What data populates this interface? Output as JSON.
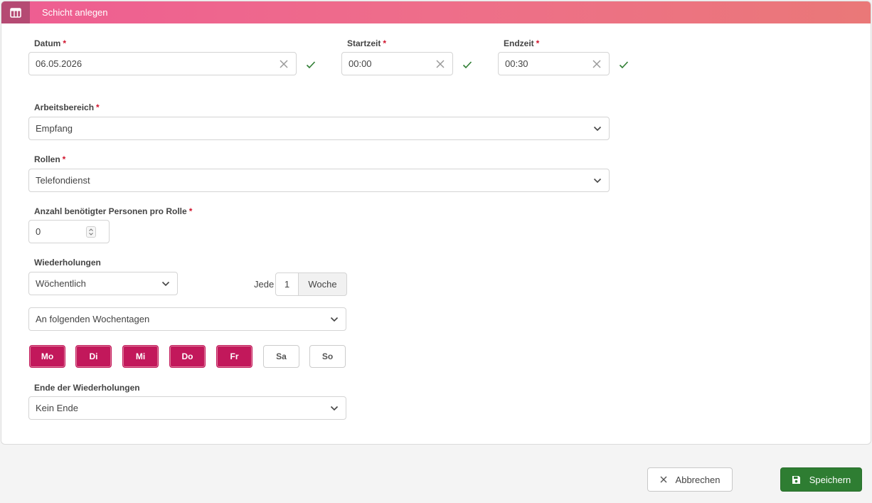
{
  "header": {
    "title": "Schicht anlegen",
    "icon": "table-icon"
  },
  "required_mark": "*",
  "datum": {
    "label": "Datum",
    "value": "06.05.2026"
  },
  "startzeit": {
    "label": "Startzeit",
    "value": "00:00"
  },
  "endzeit": {
    "label": "Endzeit",
    "value": "00:30"
  },
  "arbeitsbereich": {
    "label": "Arbeitsbereich",
    "value": "Empfang"
  },
  "rollen": {
    "label": "Rollen",
    "value": "Telefondienst"
  },
  "anzahl": {
    "label": "Anzahl benötigter Personen pro Rolle",
    "value": "0"
  },
  "wiederholungen": {
    "label": "Wiederholungen",
    "value": "Wöchentlich",
    "every_label": "Jede",
    "every_value": "1",
    "unit": "Woche",
    "mode": "An folgenden Wochentagen"
  },
  "days": [
    {
      "label": "Mo",
      "selected": true
    },
    {
      "label": "Di",
      "selected": true
    },
    {
      "label": "Mi",
      "selected": true
    },
    {
      "label": "Do",
      "selected": true
    },
    {
      "label": "Fr",
      "selected": true
    },
    {
      "label": "Sa",
      "selected": false
    },
    {
      "label": "So",
      "selected": false
    }
  ],
  "ende": {
    "label": "Ende der Wiederholungen",
    "value": "Kein Ende"
  },
  "footer": {
    "cancel_label": "Abbrechen",
    "save_label": "Speichern"
  },
  "colors": {
    "header_gradient_start": "#ee5d92",
    "header_gradient_end": "#ea7878",
    "day_selected": "#c2185b",
    "save_button": "#2e7d32",
    "valid_check": "#2e7d32"
  }
}
